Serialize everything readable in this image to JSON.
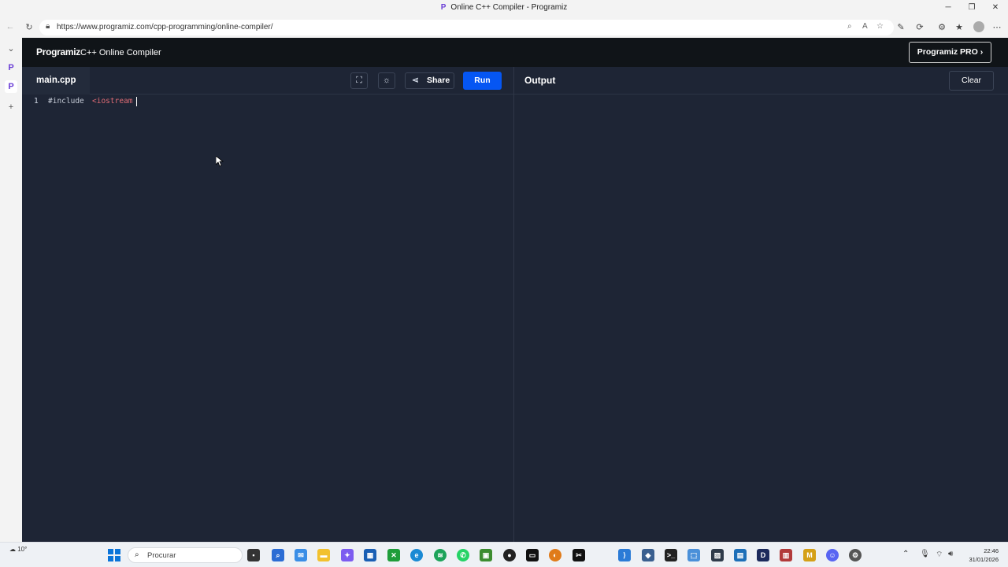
{
  "window": {
    "title": "Online C++ Compiler - Programiz",
    "favicon": "P",
    "minimize": "─",
    "restore": "❐",
    "close": "✕"
  },
  "browser": {
    "url": "https://www.programiz.com/cpp-programming/online-compiler/"
  },
  "header": {
    "logo": "Programiz",
    "title": "C++ Online Compiler",
    "pro_button": "Programiz PRO ›"
  },
  "toolbar": {
    "file_tab": "main.cpp",
    "share_label": "Share",
    "run_label": "Run",
    "output_label": "Output",
    "clear_label": "Clear"
  },
  "editor": {
    "lines": [
      {
        "number": "1",
        "keyword": "#include",
        "string": "<iostream"
      }
    ]
  },
  "taskbar": {
    "weather": "10°",
    "search_placeholder": "Procurar",
    "time": "22:46",
    "date": "31/01/2026"
  },
  "colors": {
    "app_bg": "#1e2535",
    "header_bg": "#101418",
    "run_button": "#0556f3",
    "string_token": "#e06c75"
  }
}
